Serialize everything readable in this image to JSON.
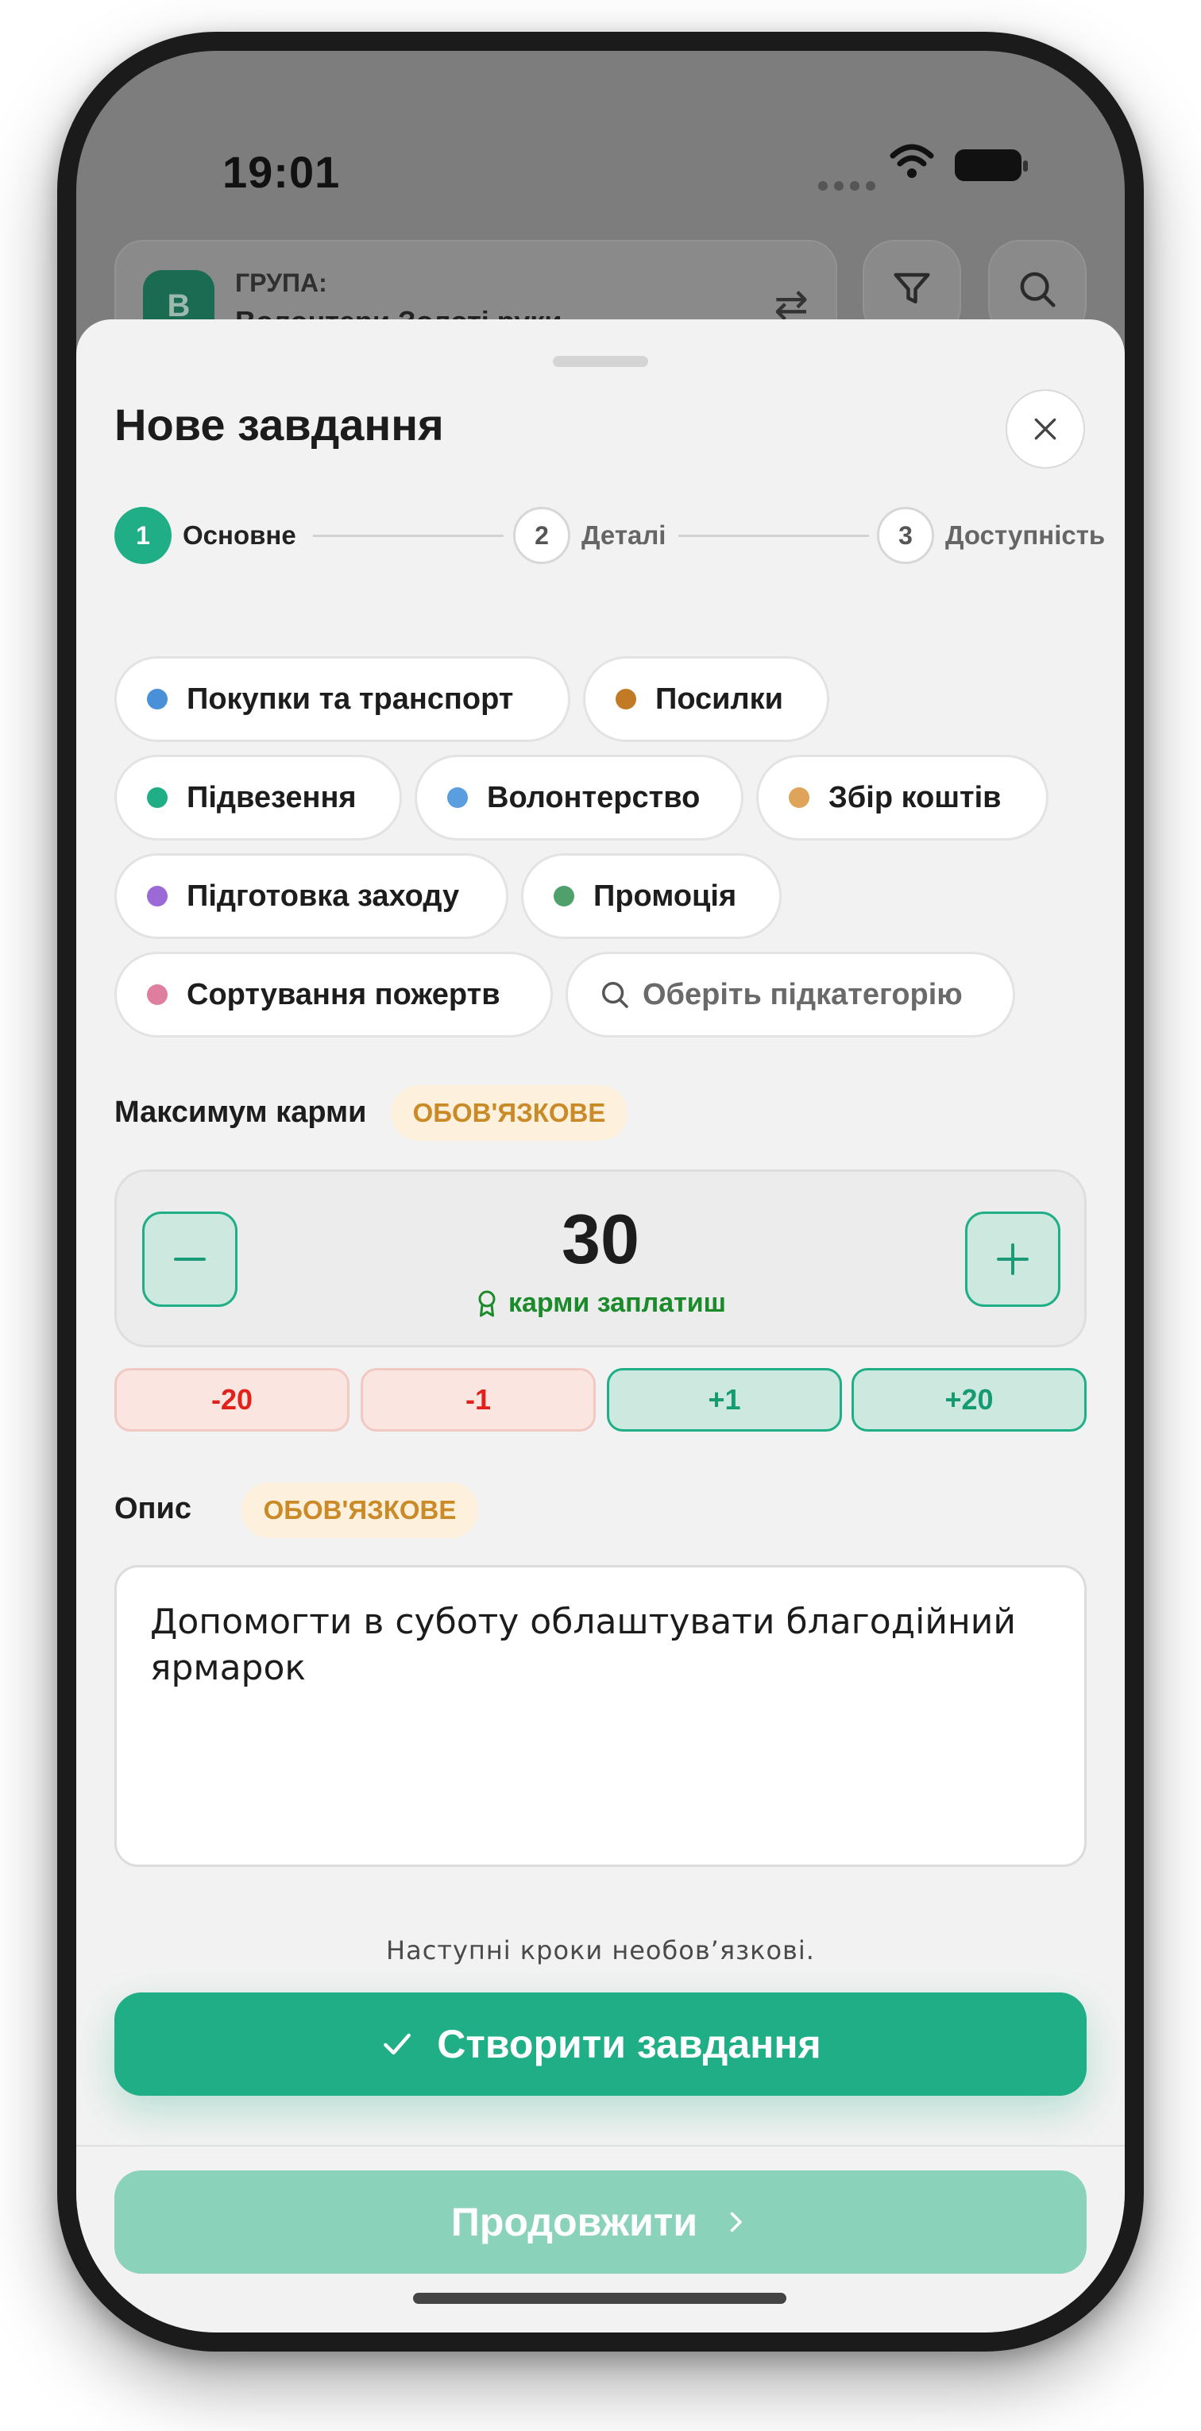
{
  "status_bar": {
    "time": "19:01"
  },
  "background": {
    "group_label": "ГРУПА:",
    "group_name": "Волонтери Золоті руки",
    "group_avatar_letter": "В"
  },
  "sheet": {
    "title": "Нове завдання",
    "steps": [
      {
        "num": "1",
        "label": "Основне",
        "active": true
      },
      {
        "num": "2",
        "label": "Деталі",
        "active": false
      },
      {
        "num": "3",
        "label": "Доступність",
        "active": false
      }
    ],
    "categories": [
      {
        "label": "Покупки та транспорт",
        "color": "#4a90d9"
      },
      {
        "label": "Посилки",
        "color": "#c27a25"
      },
      {
        "label": "Підвезення",
        "color": "#1fae86"
      },
      {
        "label": "Волонтерство",
        "color": "#5a9ee0"
      },
      {
        "label": "Збір коштів",
        "color": "#e0a35a"
      },
      {
        "label": "Підготовка заходу",
        "color": "#9b6ad6"
      },
      {
        "label": "Промоція",
        "color": "#4fa06a"
      },
      {
        "label": "Сортування пожертв",
        "color": "#e07ea0"
      }
    ],
    "subcategory_search": "Оберіть підкатегорію",
    "karma": {
      "label": "Максимум карми",
      "required_badge": "ОБОВ'ЯЗКОВЕ",
      "value": "30",
      "caption": "карми заплатиш",
      "adjustments": [
        "-20",
        "-1",
        "+1",
        "+20"
      ]
    },
    "description": {
      "label": "Опис",
      "required_badge": "ОБОВ'ЯЗКОВЕ",
      "value": "Допомогти в суботу облаштувати благодійний ярмарок"
    },
    "hint": "Наступні кроки необов’язкові.",
    "create_button": "Створити завдання",
    "continue_button": "Продовжити"
  },
  "colors": {
    "accent": "#1fae86",
    "accent_light": "#8bd2ba",
    "negative": "#e0221a",
    "warning_badge": "#c98a27"
  }
}
